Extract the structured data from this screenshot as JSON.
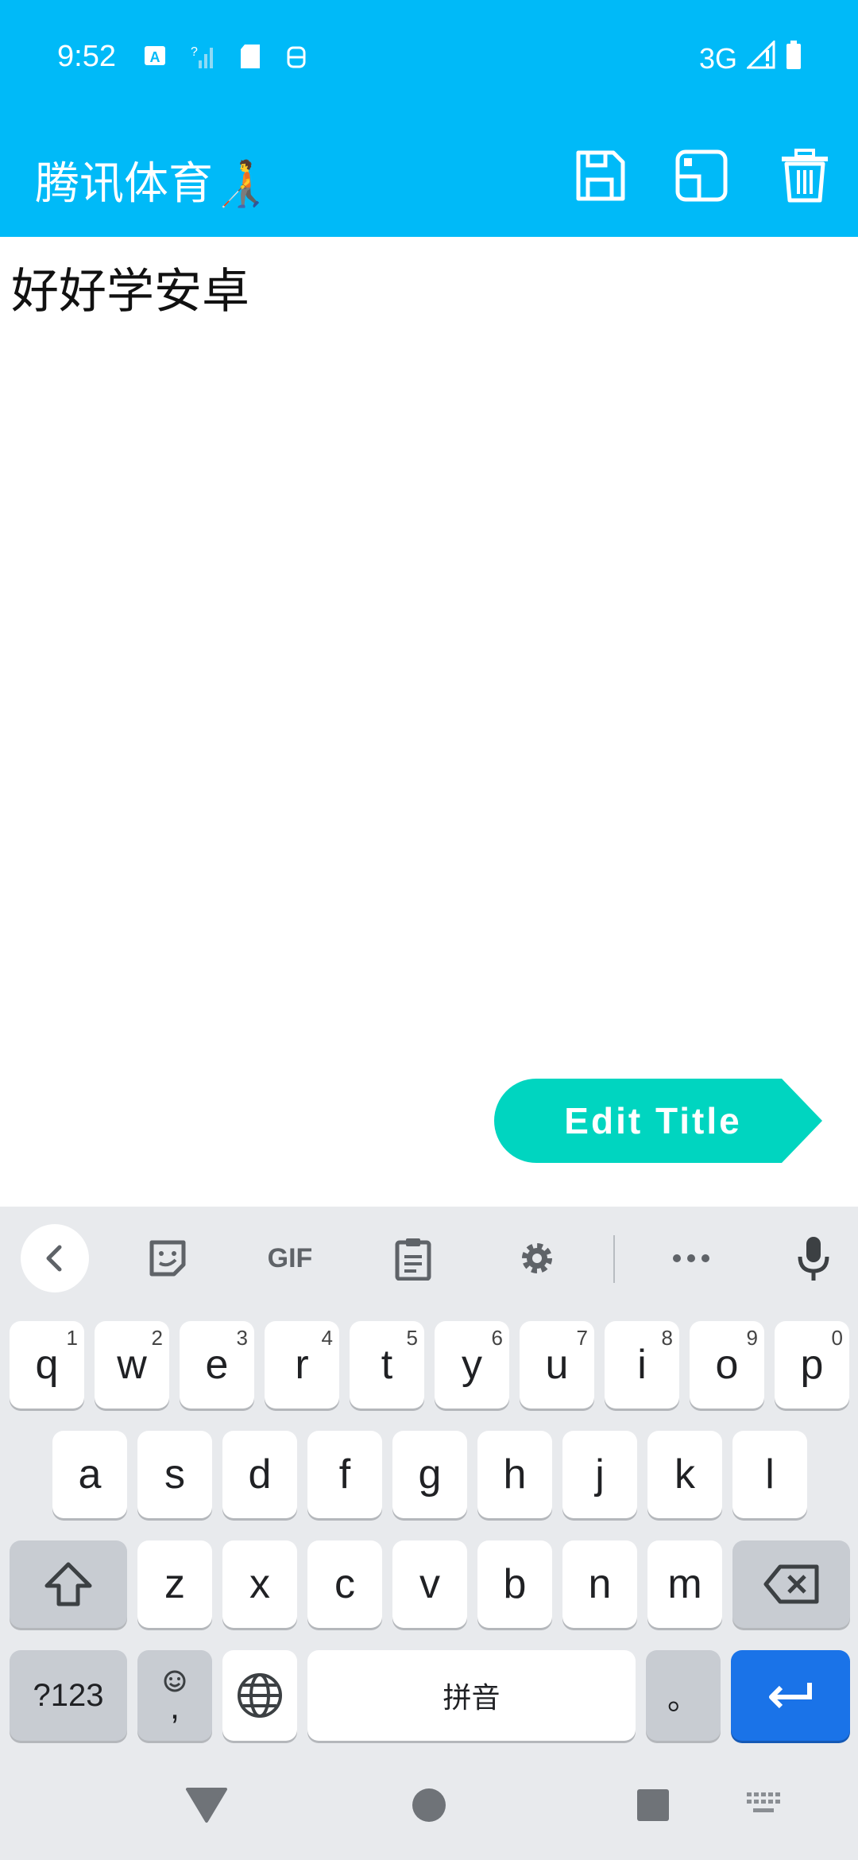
{
  "status_bar": {
    "time": "9:52",
    "network": "3G",
    "icons": [
      "keyboard-a-icon",
      "no-signal-icon",
      "sd-card-icon",
      "robot-icon",
      "signal-icon",
      "battery-icon"
    ]
  },
  "app_bar": {
    "title": "腾讯体育🧑‍🦯",
    "actions": [
      "save-icon",
      "image-icon",
      "delete-icon"
    ]
  },
  "note": {
    "content": "好好学安卓"
  },
  "fab": {
    "label": "Edit Title"
  },
  "keyboard": {
    "toolbar": {
      "gif_label": "GIF"
    },
    "row1": [
      {
        "k": "q",
        "h": "1"
      },
      {
        "k": "w",
        "h": "2"
      },
      {
        "k": "e",
        "h": "3"
      },
      {
        "k": "r",
        "h": "4"
      },
      {
        "k": "t",
        "h": "5"
      },
      {
        "k": "y",
        "h": "6"
      },
      {
        "k": "u",
        "h": "7"
      },
      {
        "k": "i",
        "h": "8"
      },
      {
        "k": "o",
        "h": "9"
      },
      {
        "k": "p",
        "h": "0"
      }
    ],
    "row2": [
      "a",
      "s",
      "d",
      "f",
      "g",
      "h",
      "j",
      "k",
      "l"
    ],
    "row3": [
      "z",
      "x",
      "c",
      "v",
      "b",
      "n",
      "m"
    ],
    "symbols_label": "?123",
    "emoji_comma": ",",
    "space_label": "拼音",
    "period_label": "。"
  },
  "colors": {
    "app_bar": "#00BAF8",
    "fab": "#00D5C0",
    "enter_key": "#1A73E8"
  }
}
